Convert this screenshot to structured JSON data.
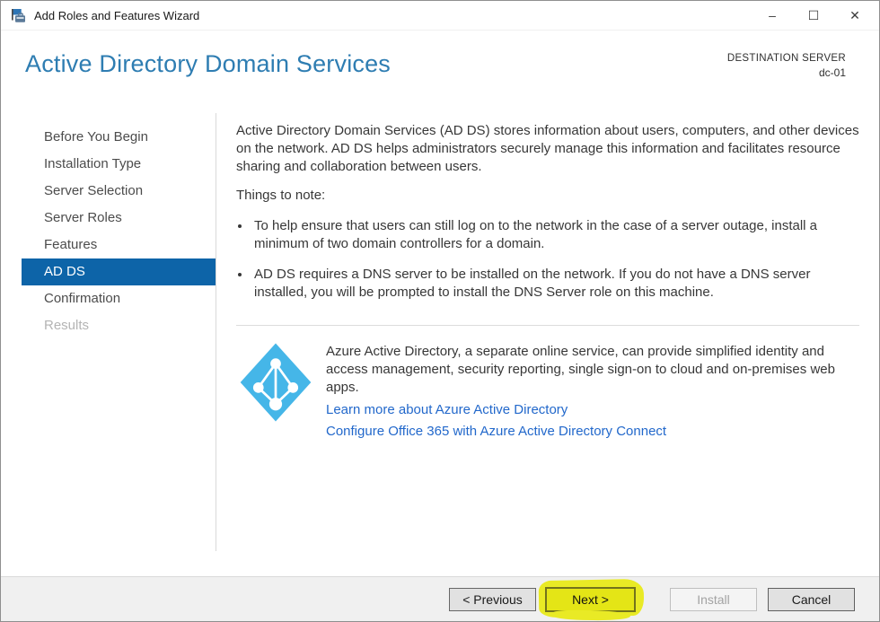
{
  "window": {
    "title": "Add Roles and Features Wizard",
    "controls": {
      "minimize": "–",
      "maximize": "☐",
      "close": "✕"
    }
  },
  "header": {
    "title": "Active Directory Domain Services",
    "destination_label": "DESTINATION SERVER",
    "destination_value": "dc-01"
  },
  "sidebar": {
    "items": [
      {
        "label": "Before You Begin",
        "state": "normal"
      },
      {
        "label": "Installation Type",
        "state": "normal"
      },
      {
        "label": "Server Selection",
        "state": "normal"
      },
      {
        "label": "Server Roles",
        "state": "normal"
      },
      {
        "label": "Features",
        "state": "normal"
      },
      {
        "label": "AD DS",
        "state": "selected"
      },
      {
        "label": "Confirmation",
        "state": "normal"
      },
      {
        "label": "Results",
        "state": "disabled"
      }
    ]
  },
  "main": {
    "intro": "Active Directory Domain Services (AD DS) stores information about users, computers, and other devices on the network.  AD DS helps administrators securely manage this information and facilitates resource sharing and collaboration between users.",
    "things_to_note_label": "Things to note:",
    "bullets": [
      "To help ensure that users can still log on to the network in the case of a server outage, install a minimum of two domain controllers for a domain.",
      "AD DS requires a DNS server to be installed on the network.  If you do not have a DNS server installed, you will be prompted to install the DNS Server role on this machine."
    ],
    "azure": {
      "description": "Azure Active Directory, a separate online service, can provide simplified identity and access management, security reporting, single sign-on to cloud and on-premises web apps.",
      "links": [
        "Learn more about Azure Active Directory",
        "Configure Office 365 with Azure Active Directory Connect"
      ]
    }
  },
  "footer": {
    "previous_label": "< Previous",
    "next_label": "Next >",
    "install_label": "Install",
    "cancel_label": "Cancel"
  },
  "colors": {
    "title_blue": "#2e7db2",
    "selection_blue": "#0d64a8",
    "link_blue": "#2268cb",
    "azure_icon_blue": "#45b6e8",
    "highlight_yellow": "#e9ea25",
    "footer_gray": "#f0f0f0"
  }
}
